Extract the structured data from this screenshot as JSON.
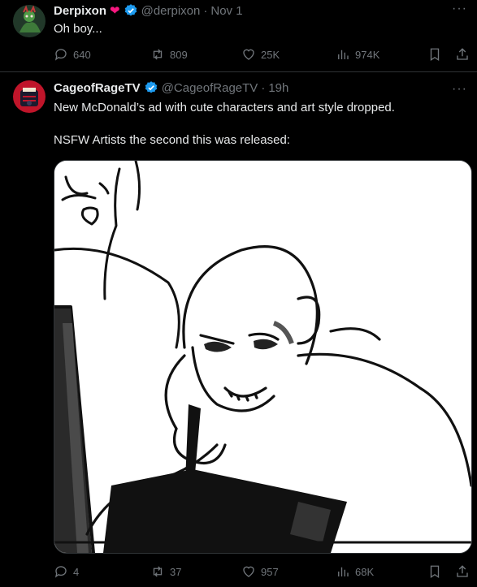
{
  "posts": [
    {
      "author": "Derpixon",
      "handle": "@derpixon",
      "separator": "·",
      "time": "Nov 1",
      "text": "Oh boy...",
      "stats": {
        "replies": "640",
        "reposts": "809",
        "likes": "25K",
        "views": "974K"
      }
    },
    {
      "author": "CageofRageTV",
      "handle": "@CageofRageTV",
      "separator": "·",
      "time": "19h",
      "text_line1": "New McDonald’s ad with cute characters and art style dropped.",
      "text_line2": "NSFW Artists the second this was released:",
      "stats": {
        "replies": "4",
        "reposts": "37",
        "likes": "957",
        "views": "68K"
      }
    }
  ],
  "icons": {
    "reply": "reply-icon",
    "repost": "repost-icon",
    "like": "heart-icon",
    "views": "views-icon",
    "bookmark": "bookmark-icon",
    "share": "share-icon",
    "more": "more-icon",
    "verified": "verified-badge-icon"
  },
  "colors": {
    "background": "#000000",
    "text": "#e7e9ea",
    "muted": "#71767b",
    "verified": "#1d9bf0",
    "heart": "#f91880"
  }
}
